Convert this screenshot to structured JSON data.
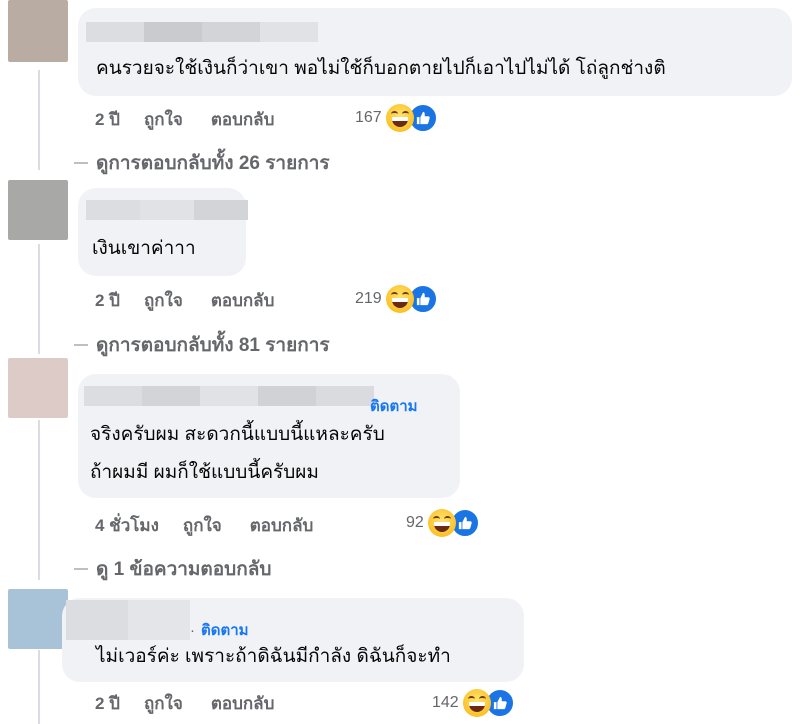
{
  "follow_label": "ติดตาม",
  "actions": {
    "like": "ถูกใจ",
    "reply": "ตอบกลับ"
  },
  "colors": {
    "bubble": "#f0f2f5",
    "secondary_text": "#65676b",
    "link": "#1877f2"
  },
  "comments": [
    {
      "text": "คนรวยจะใช้เงินก็ว่าเขา พอไม่ใช้ก็บอกตายไปก็เอาไปไม่ได้ โถ่ลูกช่างติ",
      "time": "2 ปี",
      "reaction_count": "167",
      "reactions": [
        "haha-icon",
        "like-icon"
      ],
      "view_replies": "ดูการตอบกลับทั้ง 26 รายการ"
    },
    {
      "text": "เงินเขาค่าาา",
      "time": "2 ปี",
      "reaction_count": "219",
      "reactions": [
        "haha-icon",
        "like-icon"
      ],
      "view_replies": "ดูการตอบกลับทั้ง 81 รายการ"
    },
    {
      "text_lines": [
        "จริงครับผม สะดวกนี้แบบนี้แหละครับ",
        "ถ้าผมมี ผมก็ใช้แบบนี้ครับผม"
      ],
      "time": "4 ชั่วโมง",
      "reaction_count": "92",
      "reactions": [
        "haha-icon",
        "like-icon"
      ],
      "view_replies": "ดู 1 ข้อความตอบกลับ"
    },
    {
      "separator": "·",
      "text": "ไม่เวอร์ค่ะ เพราะถ้าดิฉันมีกำลัง ดิฉันก็จะทำ",
      "time": "2 ปี",
      "reaction_count": "142",
      "reactions": [
        "haha-icon",
        "like-icon"
      ]
    }
  ]
}
